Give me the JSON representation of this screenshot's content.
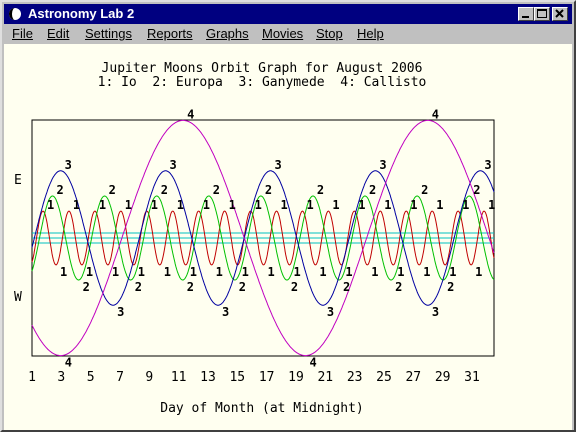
{
  "window": {
    "title": "Astronomy Lab 2",
    "icons": [
      "app-moon-icon",
      "minimize-icon",
      "maximize-icon",
      "close-icon"
    ]
  },
  "menu": [
    "File",
    "Edit",
    "Settings",
    "Reports",
    "Graphs",
    "Movies",
    "Stop",
    "Help"
  ],
  "chart_data": {
    "type": "line",
    "title": "Jupiter Moons Orbit Graph for August 2006",
    "subtitle": "1: Io  2: Europa  3: Ganymede  4: Callisto",
    "xlabel": "Day of Month (at Midnight)",
    "ylabel_top": "E",
    "ylabel_bottom": "W",
    "xlim": [
      1,
      32.5
    ],
    "x_ticks": [
      "1",
      "3",
      "5",
      "7",
      "9",
      "11",
      "13",
      "15",
      "17",
      "19",
      "21",
      "23",
      "25",
      "27",
      "29",
      "31"
    ],
    "grid": false,
    "center_line_color": "#00c0c0",
    "series": [
      {
        "name": "1",
        "color": "#c00000",
        "amplitude": 0.16,
        "period_days": 1.769,
        "first_east_max": 1.75,
        "label_every": 1
      },
      {
        "name": "2",
        "color": "#00c000",
        "amplitude": 0.25,
        "period_days": 3.551,
        "first_east_max": 2.4,
        "label_every": 1
      },
      {
        "name": "3",
        "color": "#0000a0",
        "amplitude": 0.4,
        "period_days": 7.155,
        "first_east_max": 2.95,
        "label_every": 1
      },
      {
        "name": "4",
        "color": "#c000c0",
        "amplitude": 0.7,
        "period_days": 16.689,
        "first_east_max": 11.3,
        "label_every": 1
      }
    ]
  }
}
